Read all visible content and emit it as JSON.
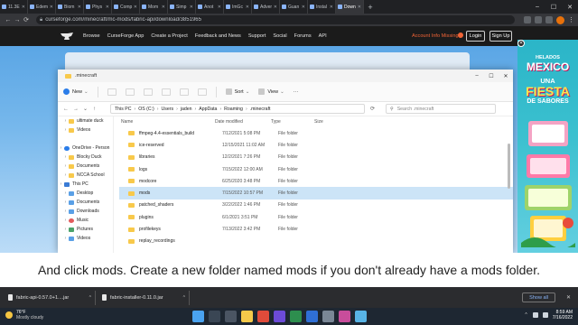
{
  "browser": {
    "tabs": [
      {
        "label": "11.3E",
        "active": false
      },
      {
        "label": "Edem",
        "active": false
      },
      {
        "label": "Biom",
        "active": false
      },
      {
        "label": "Phys",
        "active": false
      },
      {
        "label": "Comp",
        "active": false
      },
      {
        "label": "Mom",
        "active": false
      },
      {
        "label": "Simp",
        "active": false
      },
      {
        "label": "Anot",
        "active": false
      },
      {
        "label": "ImGc",
        "active": false
      },
      {
        "label": "Adver",
        "active": false
      },
      {
        "label": "Guan",
        "active": false
      },
      {
        "label": "Instal",
        "active": false
      },
      {
        "label": "Down",
        "active": true
      }
    ],
    "url": "curseforge.com/minecraft/mc-mods/fabric-api/download/3851965"
  },
  "site": {
    "nav": [
      "Browse",
      "CurseForge App",
      "Create a Project",
      "Feedback and News",
      "Support",
      "Social",
      "Forums",
      "API"
    ],
    "account_missing": "Account Info Missing?",
    "login": "Login",
    "signup": "Sign Up"
  },
  "explorer": {
    "title": ".minecraft",
    "toolbar": {
      "new": "New",
      "sort": "Sort",
      "view": "View",
      "more": "···"
    },
    "breadcrumb": [
      "This PC",
      "OS (C:)",
      "Users",
      "jaden",
      "AppData",
      "Roaming",
      ".minecraft"
    ],
    "search_placeholder": "Search .minecraft",
    "nav_items": [
      {
        "label": "ultimate duck",
        "indent": 1,
        "icon": "folder"
      },
      {
        "label": "Videos",
        "indent": 1,
        "icon": "folder"
      },
      {
        "label": "",
        "indent": 1,
        "icon": "none"
      },
      {
        "label": "OneDrive - Person",
        "indent": 0,
        "icon": "cloud"
      },
      {
        "label": "Blocky Duck",
        "indent": 1,
        "icon": "folder"
      },
      {
        "label": "Documents",
        "indent": 1,
        "icon": "folder"
      },
      {
        "label": "NCCA School",
        "indent": 1,
        "icon": "folder"
      },
      {
        "label": "This PC",
        "indent": 0,
        "icon": "pc"
      },
      {
        "label": "Desktop",
        "indent": 1,
        "icon": "disk"
      },
      {
        "label": "Documents",
        "indent": 1,
        "icon": "disk"
      },
      {
        "label": "Downloads",
        "indent": 1,
        "icon": "disk"
      },
      {
        "label": "Music",
        "indent": 1,
        "icon": "music"
      },
      {
        "label": "Pictures",
        "indent": 1,
        "icon": "pic"
      },
      {
        "label": "Videos",
        "indent": 1,
        "icon": "disk"
      }
    ],
    "columns": {
      "name": "Name",
      "date": "Date modified",
      "type": "Type",
      "size": "Size"
    },
    "files": [
      {
        "name": "ffmpeg-4.4-essentials_build",
        "date": "7/12/2021 5:08 PM",
        "type": "File folder",
        "selected": false
      },
      {
        "name": "ice-reserved",
        "date": "12/15/2021 11:02 AM",
        "type": "File folder",
        "selected": false
      },
      {
        "name": "libraries",
        "date": "12/2/2021 7:26 PM",
        "type": "File folder",
        "selected": false
      },
      {
        "name": "logs",
        "date": "7/15/2022 12:00 AM",
        "type": "File folder",
        "selected": false
      },
      {
        "name": "modcore",
        "date": "6/25/2020 3:48 PM",
        "type": "File folder",
        "selected": false
      },
      {
        "name": "mods",
        "date": "7/15/2022 10:57 PM",
        "type": "File folder",
        "selected": true
      },
      {
        "name": "patched_shaders",
        "date": "3/22/2022 1:46 PM",
        "type": "File folder",
        "selected": false
      },
      {
        "name": "plugins",
        "date": "6/1/2021 3:51 PM",
        "type": "File folder",
        "selected": false
      },
      {
        "name": "profilekeys",
        "date": "7/13/2022 3:42 PM",
        "type": "File folder",
        "selected": false
      },
      {
        "name": "replay_recordings",
        "date": "",
        "type": "",
        "selected": false
      }
    ]
  },
  "ad": {
    "brand": "HELADOS",
    "country": "MEXICO",
    "line1": "UNA",
    "line2": "FIESTA",
    "line3": "DE SABORES"
  },
  "caption": "And click mods. Create a new folder named mods if you don't already have a mods folder.",
  "downloads": {
    "items": [
      "fabric-api-0.57.0+1....jar",
      "fabric-installer-0.11.0.jar"
    ],
    "show_all": "Show all"
  },
  "taskbar": {
    "temp": "76°F",
    "condition": "Mostly cloudy",
    "time": "8:59 AM",
    "date": "7/16/2022"
  },
  "colors": {
    "accent_orange": "#f16436",
    "selection": "#cce4f7",
    "folder": "#f8c94b",
    "page_blue": "#5ba6e5",
    "ad_teal": "#2bb5c8"
  }
}
